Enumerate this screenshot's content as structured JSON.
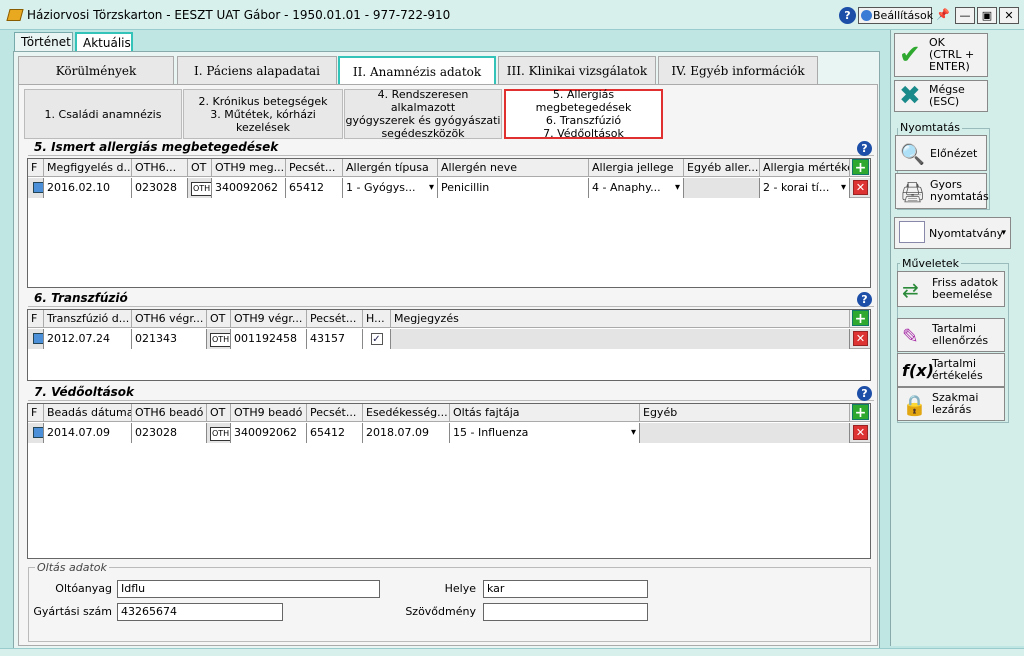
{
  "window": {
    "title": "Háziorvosi Törzskarton - EESZT UAT Gábor - 1950.01.01 - 977-722-910",
    "settings_label": "Beállítások",
    "help": "?"
  },
  "outer_tabs": [
    {
      "label": "Történet"
    },
    {
      "label": "Aktuális"
    }
  ],
  "main_tabs": [
    {
      "label": "Körülmények"
    },
    {
      "label": "I. Páciens alapadatai"
    },
    {
      "label": "II. Anamnézis adatok"
    },
    {
      "label": "III. Klinikai vizsgálatok"
    },
    {
      "label": "IV. Egyéb információk"
    }
  ],
  "sub_tabs": [
    {
      "l1": "1. Családi anamnézis"
    },
    {
      "l1": "2. Krónikus betegségek",
      "l2": "3. Műtétek, kórházi kezelések"
    },
    {
      "l1": "4. Rendszeresen alkalmazott",
      "l2": "gyógyszerek és gyógyászati",
      "l3": "segédeszközök"
    },
    {
      "l1": "5. Allergiás megbetegedések",
      "l2": "6. Transzfúzió",
      "l3": "7. Védőoltások"
    }
  ],
  "allergy": {
    "title": "5. Ismert allergiás megbetegedések",
    "headers": [
      "F",
      "Megfigyelés d...",
      "OTH6...",
      "OT",
      "OTH9 meg...",
      "Pecsét...",
      "Allergén típusa",
      "Allergén neve",
      "Allergia jellege",
      "Egyéb aller...",
      "Allergia mértéke"
    ],
    "row": {
      "date": "2016.02.10",
      "oth6": "023028",
      "ot": "OTH",
      "oth9": "340092062",
      "pecset": "65412",
      "tipus": "1 - Gyógys...",
      "nev": "Penicillin",
      "jelleg": "4 - Anaphy...",
      "egyeb": "",
      "mertek": "2 - korai tí..."
    }
  },
  "transfusion": {
    "title": "6. Transzfúzió",
    "headers": [
      "F",
      "Transzfúzió d...",
      "OTH6 végr...",
      "OT",
      "OTH9 végr...",
      "Pecsét...",
      "H...",
      "Megjegyzés"
    ],
    "row": {
      "date": "2012.07.24",
      "oth6": "021343",
      "ot": "OTH",
      "oth9": "001192458",
      "pecset": "43157",
      "h": "✓",
      "megj": ""
    }
  },
  "vaccination": {
    "title": "7. Védőoltások",
    "headers": [
      "F",
      "Beadás dátuma",
      "OTH6 beadó",
      "OT",
      "OTH9 beadó",
      "Pecsét...",
      "Esedékesség...",
      "Oltás fajtája",
      "Egyéb"
    ],
    "row": {
      "date": "2014.07.09",
      "oth6": "023028",
      "ot": "OTH",
      "oth9": "340092062",
      "pecset": "65412",
      "esed": "2018.07.09",
      "fajta": "15 - Influenza",
      "egyeb": ""
    }
  },
  "oltas_adatok": {
    "legend": "Oltás adatok",
    "oltoanyag_label": "Oltóanyag",
    "oltoanyag": "Idflu",
    "gyartasi_label": "Gyártási szám",
    "gyartasi": "43265674",
    "helye_label": "Helye",
    "helye": "kar",
    "szovodmeny_label": "Szövődmény",
    "szovodmeny": ""
  },
  "sidebar": {
    "ok": "OK\n(CTRL +\nENTER)",
    "cancel": "Mégse\n(ESC)",
    "print_group": "Nyomtatás",
    "preview": "Előnézet",
    "quick_print": "Gyors\nnyomtatás",
    "form": "Nyomtatvány",
    "ops_group": "Műveletek",
    "fetch": "Friss adatok\nbeemelése",
    "content_check": "Tartalmi\nellenőrzés",
    "content_eval": "Tartalmi\nértékelés",
    "prof_close": "Szakmai\nlezárás"
  },
  "colors": {
    "accent": "#33c3b9",
    "highlight": "#e03030",
    "background": "#bfe6e2"
  }
}
